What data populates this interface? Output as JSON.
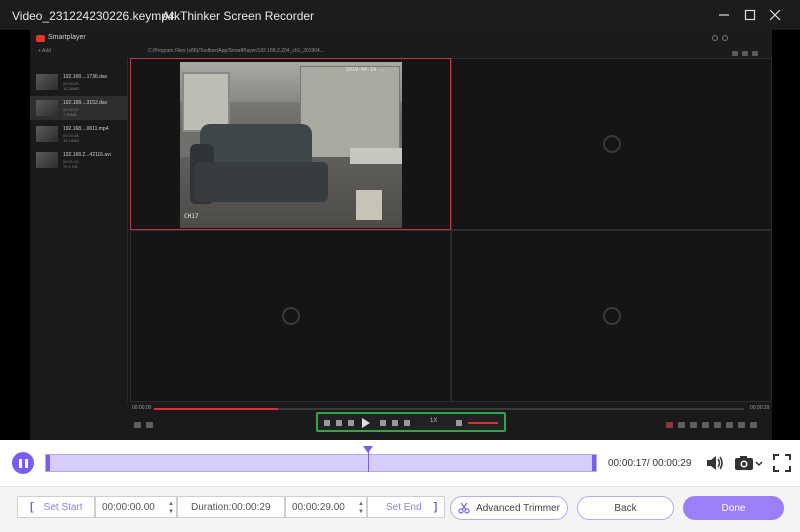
{
  "window": {
    "file_title": "Video_231224230226.keymp4",
    "app_title": "ArkThinker Screen Recorder",
    "minimize_icon": "minimize-icon",
    "maximize_icon": "maximize-icon",
    "close_icon": "close-icon"
  },
  "player": {
    "app_name": "Smartplayer",
    "add_label": "+ Add",
    "path": "C:/Program Files (x86)/Toolbox/App/SmartPlayer/192.168.2.204_ch1_201904...",
    "files": [
      {
        "name": "192.168....1736.dav",
        "meta1": "00:00:25",
        "meta2": "16.28MB"
      },
      {
        "name": "192.168....3152.dav",
        "meta1": "00:00:29",
        "meta2": "7.95MB"
      },
      {
        "name": "192.168....0611.mp4",
        "meta1": "00:00:48",
        "meta2": "15.19MB"
      },
      {
        "name": "192.168.2...42116.avi",
        "meta1": "00:01:12",
        "meta2": "70.1 KB"
      }
    ],
    "camera_timestamp": "2019-04-19 ...",
    "camera_label": "CH17",
    "time_current": "00:00:00",
    "time_total": "00:00:29",
    "progress_fraction": 0.21,
    "speed": "1X"
  },
  "recorder": {
    "time_readout": "00:00:17/ 00:00:29",
    "playhead_fraction": 0.586,
    "set_start": "Set Start",
    "start_time": "00:00:00.00",
    "duration": "Duration:00:00:29",
    "end_time": "00:00:29.00",
    "set_end": "Set End",
    "advanced_trimmer": "Advanced Trimmer",
    "back": "Back",
    "done": "Done"
  },
  "colors": {
    "accent": "#7b5cf0",
    "done_button": "#9b7ef8",
    "titlebar": "#1c1c1c",
    "highlight_green": "#2fa64b"
  }
}
